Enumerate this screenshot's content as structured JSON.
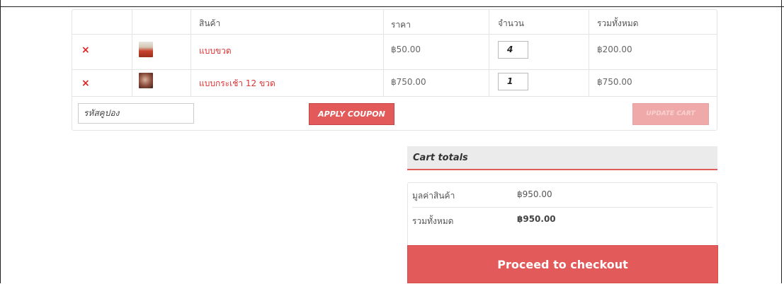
{
  "cart": {
    "headers": {
      "product": "สินค้า",
      "price": "ราคา",
      "quantity": "จำนวน",
      "total": "รวมทั้งหมด"
    },
    "items": [
      {
        "remove_symbol": "×",
        "thumb_icon": "bottle-thumbnail",
        "name": "แบบขวด",
        "price": "฿50.00",
        "quantity": "4",
        "total": "฿200.00"
      },
      {
        "remove_symbol": "×",
        "thumb_icon": "basket-thumbnail",
        "name": "แบบกระเช้า 12 ขวด",
        "price": "฿750.00",
        "quantity": "1",
        "total": "฿750.00"
      }
    ],
    "coupon_placeholder": "รหัสคูปอง",
    "apply_coupon_label": "APPLY COUPON",
    "update_cart_label": "UPDATE CART"
  },
  "totals": {
    "title": "Cart totals",
    "subtotal_label": "มูลค่าสินค้า",
    "subtotal_value": "฿950.00",
    "total_label": "รวมทั้งหมด",
    "total_value": "฿950.00",
    "checkout_label": "Proceed to checkout"
  },
  "colors": {
    "accent": "#e25a5a",
    "link": "#dd3333",
    "remove": "#e02020",
    "disabled_button": "#f0a9a9"
  }
}
